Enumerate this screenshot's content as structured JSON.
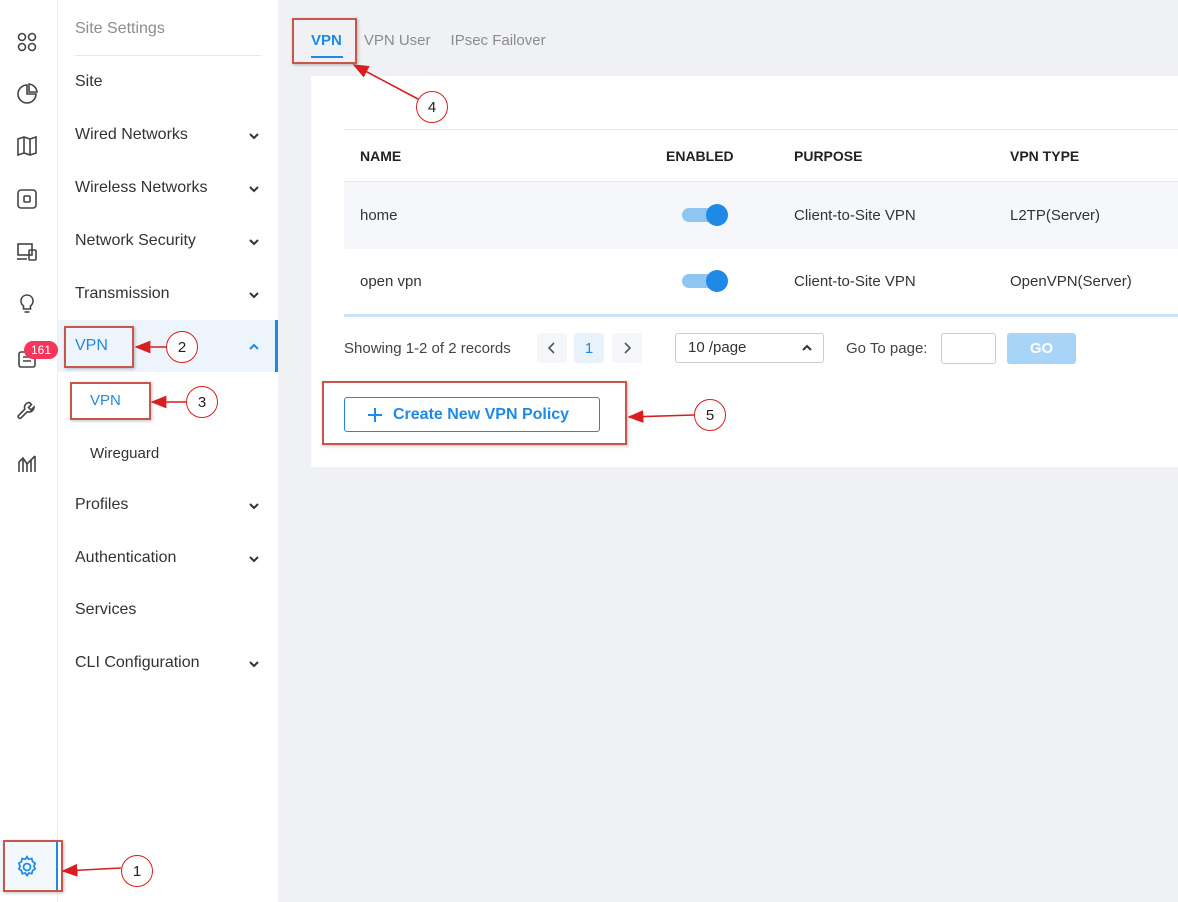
{
  "rail": {
    "icons": [
      "dashboard-icon",
      "statistics-icon",
      "map-icon",
      "devices-icon",
      "clients-icon",
      "insights-icon",
      "logs-icon",
      "tools-icon",
      "reports-icon",
      "settings-icon"
    ],
    "logs_badge": "161"
  },
  "subnav": {
    "title": "Site Settings",
    "items": [
      {
        "label": "Site"
      },
      {
        "label": "Wired Networks"
      },
      {
        "label": "Wireless Networks"
      },
      {
        "label": "Network Security"
      },
      {
        "label": "Transmission"
      },
      {
        "label": "VPN"
      },
      {
        "label": "Profiles"
      },
      {
        "label": "Authentication"
      },
      {
        "label": "Services"
      },
      {
        "label": "CLI Configuration"
      }
    ],
    "vpn_children": [
      {
        "label": "VPN"
      },
      {
        "label": "Wireguard"
      }
    ]
  },
  "tabs": [
    {
      "label": "VPN"
    },
    {
      "label": "VPN User"
    },
    {
      "label": "IPsec Failover"
    }
  ],
  "table": {
    "headers": [
      "NAME",
      "ENABLED",
      "PURPOSE",
      "VPN TYPE"
    ],
    "rows": [
      {
        "name": "home",
        "enabled": true,
        "purpose": "Client-to-Site VPN",
        "vpn_type": "L2TP(Server)"
      },
      {
        "name": "open vpn",
        "enabled": true,
        "purpose": "Client-to-Site VPN",
        "vpn_type": "OpenVPN(Server)"
      }
    ]
  },
  "pagination": {
    "summary": "Showing 1-2 of 2 records",
    "current_page": "1",
    "page_size": "10 /page",
    "goto_label": "Go To page:",
    "goto_value": "",
    "go_label": "GO"
  },
  "create_button": {
    "label": "Create New VPN Policy"
  },
  "colors": {
    "accent": "#1f8ae5",
    "badge": "#f5365c",
    "annotation": "#d81e1e"
  },
  "annotations": [
    "1",
    "2",
    "3",
    "4",
    "5"
  ]
}
